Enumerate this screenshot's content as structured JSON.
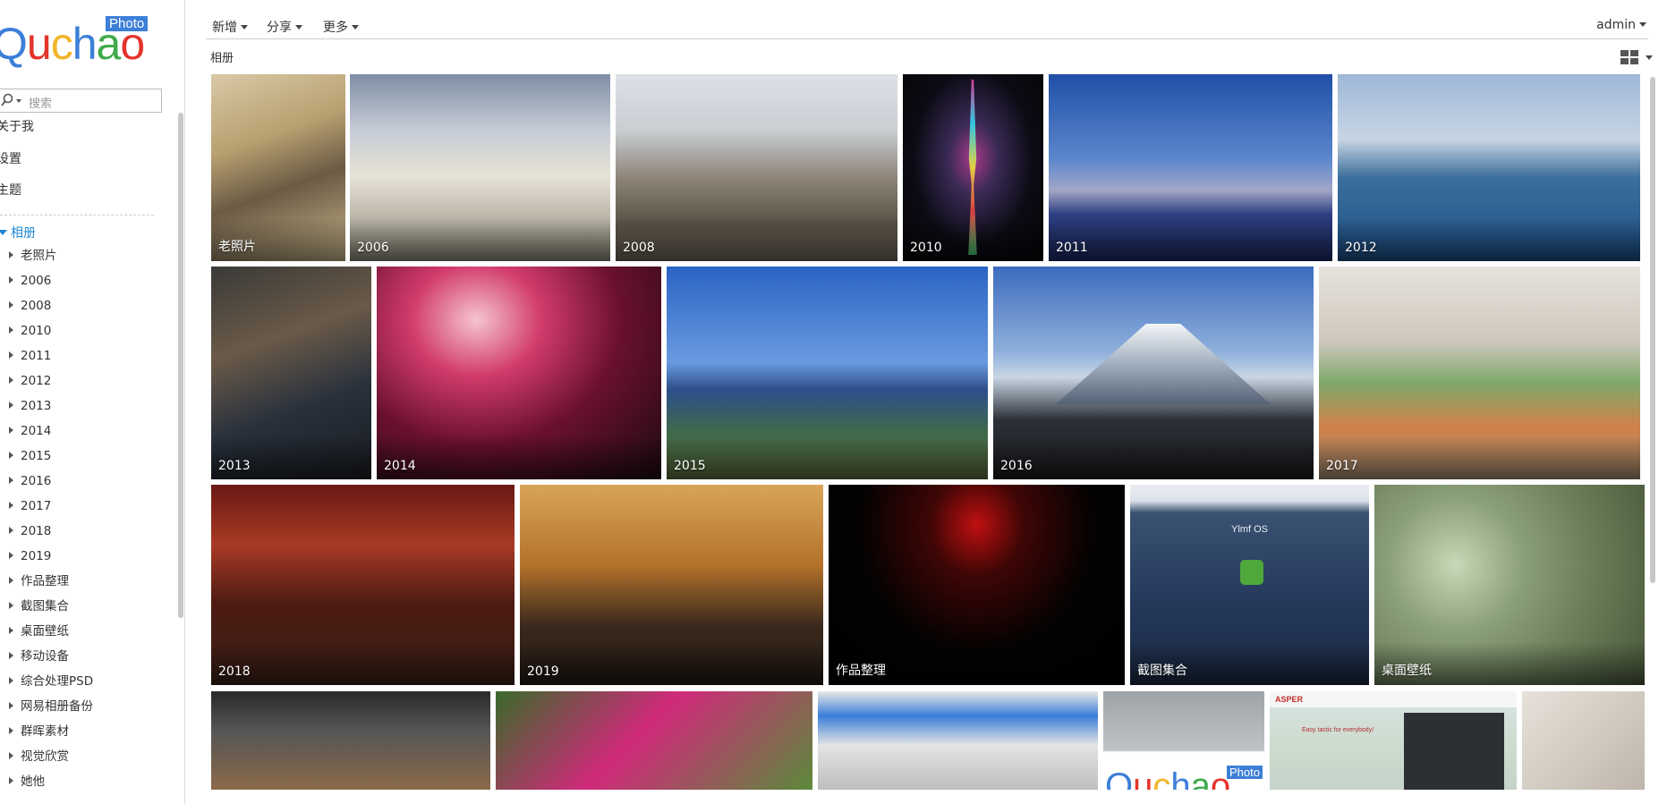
{
  "app": {
    "logo_word": "Quchao",
    "logo_badge": "Photo"
  },
  "sidebar": {
    "search_placeholder": "搜索",
    "links": [
      "关于我",
      "设置",
      "主题"
    ],
    "album_root": "相册",
    "tree": [
      "老照片",
      "2006",
      "2008",
      "2010",
      "2011",
      "2012",
      "2013",
      "2014",
      "2015",
      "2016",
      "2017",
      "2018",
      "2019",
      "作品整理",
      "截图集合",
      "桌面壁纸",
      "移动设备",
      "综合处理PSD",
      "网易相册备份",
      "群晖素材",
      "视觉欣赏",
      "她他"
    ]
  },
  "toolbar": {
    "menus": [
      "新增",
      "分享",
      "更多"
    ],
    "user": "admin"
  },
  "breadcrumb": "相册",
  "colors": {
    "accent": "#1e88d6",
    "badge": "#3d7fd8"
  },
  "gallery": {
    "albums": [
      "老照片",
      "2006",
      "2008",
      "2010",
      "2011",
      "2012",
      "2013",
      "2014",
      "2015",
      "2016",
      "2017",
      "2018",
      "2019",
      "作品整理",
      "截图集合",
      "桌面壁纸",
      "",
      "",
      "",
      "",
      "",
      ""
    ],
    "screenshot_text": {
      "ylmf_title": "Ylmf OS",
      "asper": "ASPER",
      "easy_tactic": "Easy tactic for everybody!"
    }
  }
}
